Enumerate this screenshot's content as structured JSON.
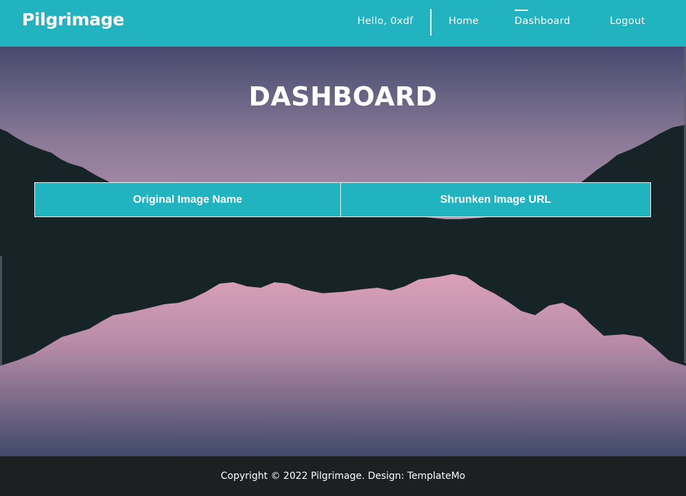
{
  "site": {
    "brand": "Pilgrimage"
  },
  "nav": {
    "greeting": "Hello, 0xdf",
    "links": [
      {
        "label": "Home",
        "active": false
      },
      {
        "label": "Dashboard",
        "active": true
      },
      {
        "label": "Logout",
        "active": false
      }
    ]
  },
  "main": {
    "title": "DASHBOARD",
    "table": {
      "columns": [
        "Original Image Name",
        "Shrunken Image URL"
      ],
      "rows": []
    }
  },
  "footer": {
    "copyright_text": "Copyright © 2022 Pilgrimage. Design: ",
    "design_credit": "TemplateMo"
  },
  "colors": {
    "accent": "#22b3c1",
    "footer_bg": "#1e1f21",
    "mountain_dark": "#172427",
    "sky_top": "#464a6e",
    "sky_pink": "#c99db8",
    "water_pink": "#e4a6bf"
  }
}
